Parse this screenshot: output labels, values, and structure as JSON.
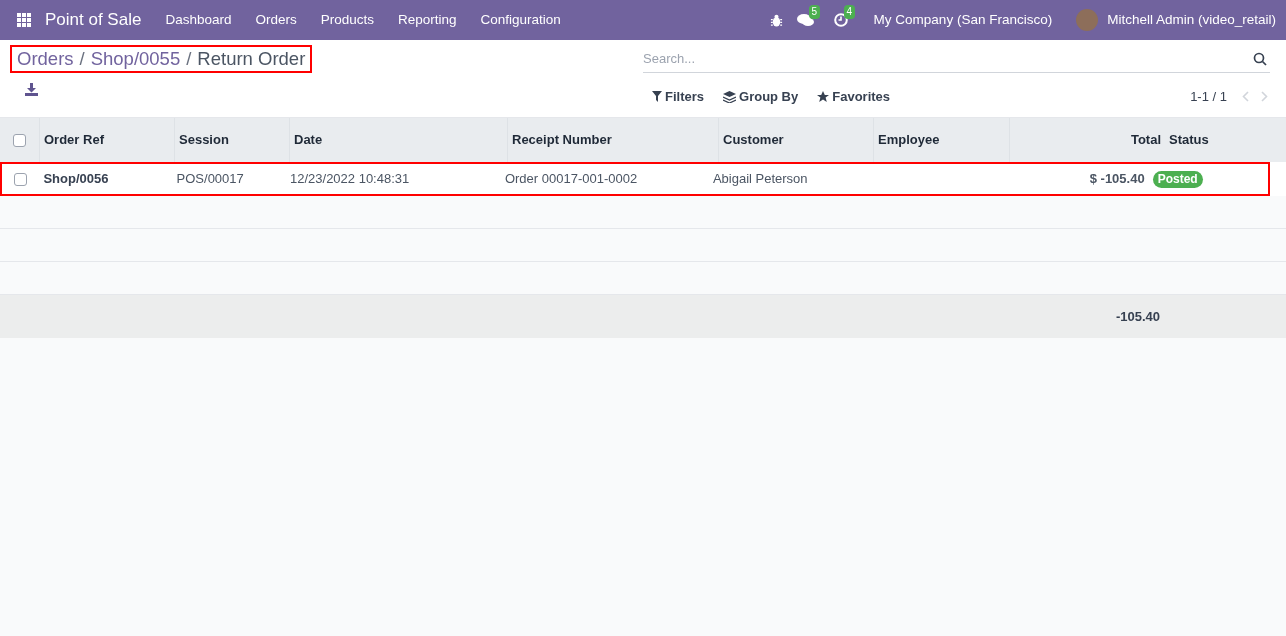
{
  "navbar": {
    "app": "Point of Sale",
    "menu": [
      "Dashboard",
      "Orders",
      "Products",
      "Reporting",
      "Configuration"
    ],
    "messages_count": "5",
    "activities_count": "4",
    "company": "My Company (San Francisco)",
    "user": "Mitchell Admin (video_retail)"
  },
  "breadcrumb": {
    "items": [
      "Orders",
      "Shop/0055",
      "Return Order"
    ],
    "separators": [
      "/",
      "/"
    ],
    "highlighted": true
  },
  "search": {
    "placeholder": "Search..."
  },
  "filters": [
    "Filters",
    "Group By",
    "Favorites"
  ],
  "pager": "1-1 / 1",
  "table": {
    "all_checked": false,
    "columns": [
      "Order Ref",
      "Session",
      "Date",
      "Receipt Number",
      "Customer",
      "Employee",
      "Total",
      "Status"
    ],
    "rows": [
      {
        "checked": false,
        "highlighted": true,
        "cells": [
          "Shop/0056",
          "POS/00017",
          "12/23/2022 10:48:31",
          "Order 00017-001-0002",
          "Abigail Peterson",
          "",
          "$ -105.40",
          "Posted"
        ]
      }
    ],
    "total": "-105.40"
  }
}
